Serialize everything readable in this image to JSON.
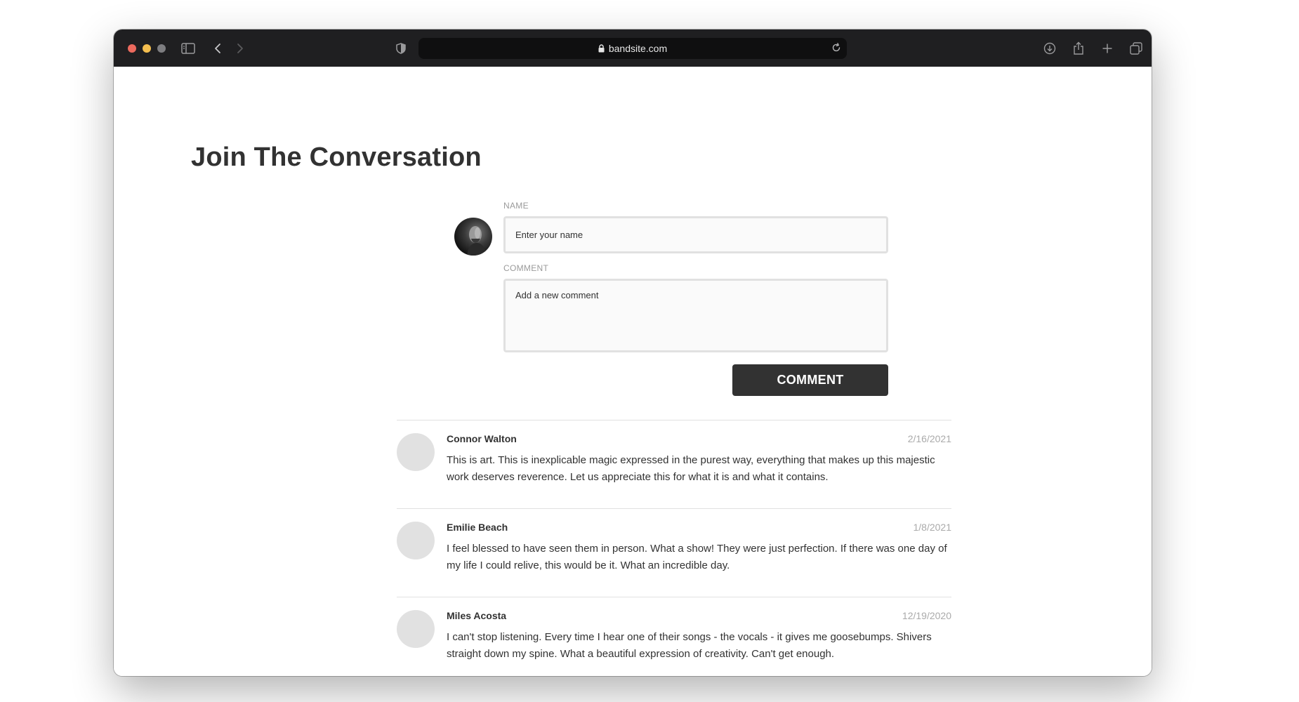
{
  "browser": {
    "url": "bandsite.com",
    "colors": {
      "toolbar": "#1f1f21",
      "close": "#ec6a5e",
      "minimize": "#f4be4f",
      "maximize_inactive": "#7d7d80"
    },
    "icons": [
      "sidebar-toggle-icon",
      "back-icon",
      "forward-icon",
      "privacy-shield-icon",
      "lock-icon",
      "reload-icon",
      "download-icon",
      "share-icon",
      "new-tab-icon",
      "tab-overview-icon"
    ]
  },
  "page": {
    "title": "Join The Conversation",
    "form": {
      "name_label": "NAME",
      "name_placeholder": "Enter your name",
      "comment_label": "COMMENT",
      "comment_placeholder": "Add a new comment",
      "submit_label": "COMMENT"
    },
    "comments": [
      {
        "name": "Connor Walton",
        "date": "2/16/2021",
        "text": "This is art. This is inexplicable magic expressed in the purest way, everything that makes up this majestic work deserves reverence. Let us appreciate this for what it is and what it contains."
      },
      {
        "name": "Emilie Beach",
        "date": "1/8/2021",
        "text": "I feel blessed to have seen them in person. What a show! They were just perfection. If there was one day of my life I could relive, this would be it. What an incredible day."
      },
      {
        "name": "Miles Acosta",
        "date": "12/19/2020",
        "text": "I can't stop listening. Every time I hear one of their songs - the vocals - it gives me goosebumps. Shivers straight down my spine. What a beautiful expression of creativity. Can't get enough."
      }
    ],
    "colors": {
      "text": "#323232",
      "button": "#323232",
      "border": "#e1e1e1",
      "muted": "#aaaaaa"
    }
  }
}
